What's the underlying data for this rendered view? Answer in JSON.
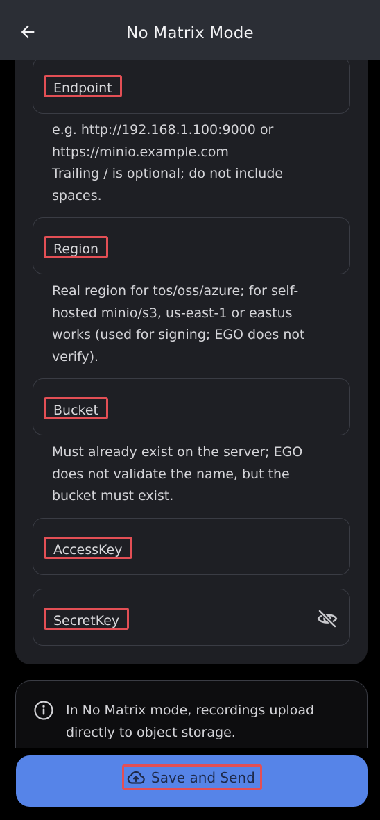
{
  "header": {
    "title": "No Matrix Mode",
    "back_icon": "arrow-left-icon"
  },
  "form": {
    "endpoint": {
      "label": "Endpoint",
      "helper_lines": [
        "e.g. http://192.168.1.100:9000 or",
        "https://minio.example.com",
        "Trailing / is optional; do not include",
        "spaces."
      ]
    },
    "region": {
      "label": "Region",
      "helper_lines": [
        "Real region for tos/oss/azure; for self-",
        "hosted minio/s3, us-east-1 or eastus",
        "works (used for signing; EGO does not",
        "verify)."
      ]
    },
    "bucket": {
      "label": "Bucket",
      "helper_lines": [
        "Must already exist on the server; EGO",
        "does not validate the name, but the",
        "bucket must exist."
      ]
    },
    "access_key": {
      "label": "AccessKey"
    },
    "secret_key": {
      "label": "SecretKey",
      "visibility_icon": "eye-off-icon"
    }
  },
  "info": {
    "icon": "info-icon",
    "lines": [
      "In No Matrix mode, recordings upload",
      "directly to object storage."
    ]
  },
  "actions": {
    "save_label": "Save and Send",
    "save_icon": "cloud-upload-icon"
  },
  "colors": {
    "header_bg": "#2b2e35",
    "card_bg": "#1e1f24",
    "accent": "#5684e8",
    "highlight": "#e34f55"
  }
}
